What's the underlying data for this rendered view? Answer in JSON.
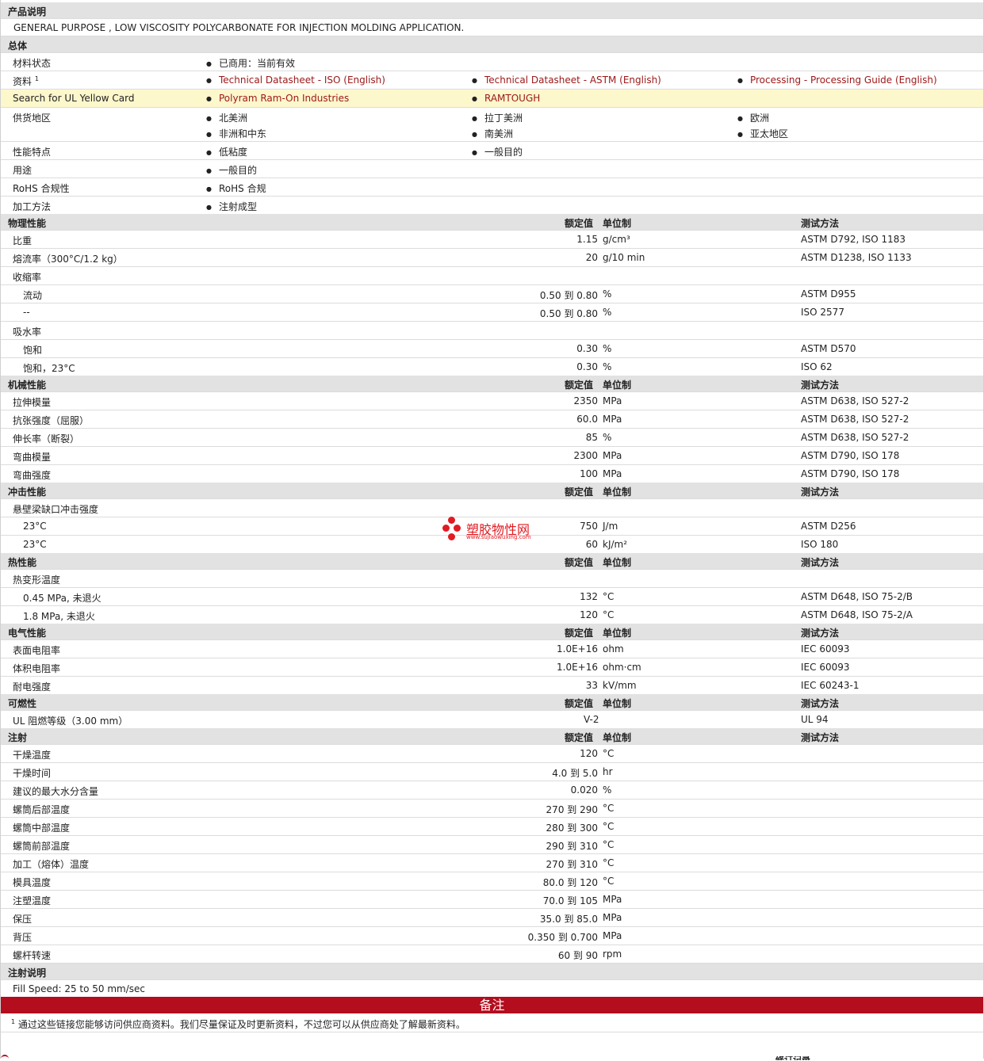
{
  "product_description": {
    "title": "产品说明",
    "text": "GENERAL PURPOSE , LOW VISCOSITY POLYCARBONATE FOR INJECTION MOLDING APPLICATION."
  },
  "general": {
    "title": "总体",
    "status_label": "材料状态",
    "status_value": "已商用：当前有效",
    "resources_label": "资料",
    "resources_sup": "1",
    "resources": [
      "Technical Datasheet - ISO (English)",
      "Technical Datasheet - ASTM (English)",
      "Processing - Processing Guide (English)"
    ],
    "ul_label": "Search for UL Yellow Card",
    "ul_links": [
      "Polyram Ram-On Industries",
      "RAMTOUGH"
    ],
    "supply_label": "供货地区",
    "supply": [
      "北美洲",
      "拉丁美洲",
      "欧洲",
      "非洲和中东",
      "南美洲",
      "亚太地区"
    ],
    "features_label": "性能特点",
    "features": [
      "低粘度",
      "一般目的"
    ],
    "uses_label": "用途",
    "uses": [
      "一般目的"
    ],
    "rohs_label": "RoHS 合规性",
    "rohs": [
      "RoHS 合规"
    ],
    "processing_label": "加工方法",
    "processing": [
      "注射成型"
    ]
  },
  "headers": {
    "nominal": "额定值",
    "unit": "单位制",
    "method": "测试方法"
  },
  "physical": {
    "title": "物理性能",
    "rows": [
      {
        "label": "比重",
        "value": "1.15",
        "unit": "g/cm³",
        "method": "ASTM D792, ISO 1183"
      },
      {
        "label": "熔流率（300°C/1.2 kg）",
        "value": "20",
        "unit": "g/10 min",
        "method": "ASTM D1238, ISO 1133"
      },
      {
        "label": "收缩率",
        "value": "",
        "unit": "",
        "method": ""
      },
      {
        "label": "流动",
        "value": "0.50 到  0.80",
        "unit": "%",
        "method": "ASTM D955",
        "sub": true
      },
      {
        "label": "--",
        "value": "0.50 到  0.80",
        "unit": "%",
        "method": "ISO 2577",
        "sub": true
      },
      {
        "label": "吸水率",
        "value": "",
        "unit": "",
        "method": ""
      },
      {
        "label": "饱和",
        "value": "0.30",
        "unit": "%",
        "method": "ASTM D570",
        "sub": true
      },
      {
        "label": "饱和，23°C",
        "value": "0.30",
        "unit": "%",
        "method": "ISO 62",
        "sub": true
      }
    ]
  },
  "mechanical": {
    "title": "机械性能",
    "rows": [
      {
        "label": "拉伸模量",
        "value": "2350",
        "unit": "MPa",
        "method": "ASTM D638, ISO 527-2"
      },
      {
        "label": "抗张强度（屈服）",
        "value": "60.0",
        "unit": "MPa",
        "method": "ASTM D638, ISO 527-2"
      },
      {
        "label": "伸长率（断裂）",
        "value": "85",
        "unit": "%",
        "method": "ASTM D638, ISO 527-2"
      },
      {
        "label": "弯曲模量",
        "value": "2300",
        "unit": "MPa",
        "method": "ASTM D790, ISO 178"
      },
      {
        "label": "弯曲强度",
        "value": "100",
        "unit": "MPa",
        "method": "ASTM D790, ISO 178"
      }
    ]
  },
  "impact": {
    "title": "冲击性能",
    "rows": [
      {
        "label": "悬壁梁缺口冲击强度",
        "value": "",
        "unit": "",
        "method": ""
      },
      {
        "label": "23°C",
        "value": "750",
        "unit": "J/m",
        "method": "ASTM D256",
        "sub": true
      },
      {
        "label": "23°C",
        "value": "60",
        "unit": "kJ/m²",
        "method": "ISO 180",
        "sub": true
      }
    ]
  },
  "thermal": {
    "title": "热性能",
    "rows": [
      {
        "label": "热变形温度",
        "value": "",
        "unit": "",
        "method": ""
      },
      {
        "label": "0.45 MPa, 未退火",
        "value": "132",
        "unit": "°C",
        "method": "ASTM D648, ISO 75-2/B",
        "sub": true
      },
      {
        "label": "1.8 MPa, 未退火",
        "value": "120",
        "unit": "°C",
        "method": "ASTM D648, ISO 75-2/A",
        "sub": true
      }
    ]
  },
  "electrical": {
    "title": "电气性能",
    "rows": [
      {
        "label": "表面电阻率",
        "value": "1.0E+16",
        "unit": "ohm",
        "method": "IEC 60093"
      },
      {
        "label": "体积电阻率",
        "value": "1.0E+16",
        "unit": "ohm·cm",
        "method": "IEC 60093"
      },
      {
        "label": "耐电强度",
        "value": "33",
        "unit": "kV/mm",
        "method": "IEC 60243-1"
      }
    ]
  },
  "flammability": {
    "title": "可燃性",
    "rows": [
      {
        "label": "UL 阻燃等级（3.00 mm）",
        "value": "V-2",
        "unit": "",
        "method": "UL 94",
        "left_value": true
      }
    ]
  },
  "injection": {
    "title": "注射",
    "rows": [
      {
        "label": "干燥温度",
        "value": "120",
        "unit": "°C",
        "method": ""
      },
      {
        "label": "干燥时间",
        "value": "4.0 到  5.0",
        "unit": "hr",
        "method": ""
      },
      {
        "label": "建议的最大水分含量",
        "value": "0.020",
        "unit": "%",
        "method": ""
      },
      {
        "label": "螺筒后部温度",
        "value": "270 到  290",
        "unit": "°C",
        "method": ""
      },
      {
        "label": "螺筒中部温度",
        "value": "280 到  300",
        "unit": "°C",
        "method": ""
      },
      {
        "label": "螺筒前部温度",
        "value": "290 到  310",
        "unit": "°C",
        "method": ""
      },
      {
        "label": "加工（熔体）温度",
        "value": "270 到  310",
        "unit": "°C",
        "method": ""
      },
      {
        "label": "模具温度",
        "value": "80.0 到  120",
        "unit": "°C",
        "method": ""
      },
      {
        "label": "注塑温度",
        "value": "70.0 到  105",
        "unit": "MPa",
        "method": ""
      },
      {
        "label": "保压",
        "value": "35.0 到  85.0",
        "unit": "MPa",
        "method": ""
      },
      {
        "label": "背压",
        "value": "0.350 到  0.700",
        "unit": "MPa",
        "method": ""
      },
      {
        "label": "螺杆转速",
        "value": "60 到  90",
        "unit": "rpm",
        "method": ""
      }
    ]
  },
  "injection_notes": {
    "title": "注射说明",
    "text": "Fill Speed: 25 to 50 mm/sec"
  },
  "notes": {
    "title": "备注",
    "sup": "1",
    "text": "通过这些链接您能够访问供应商资料。我们尽量保证及时更新资料，不过您可以从供应商处了解最新资料。"
  },
  "watermark": {
    "name": "塑胶物性网",
    "url": "www.sujiaowuxing.com"
  },
  "footer_partial": "修订记录"
}
